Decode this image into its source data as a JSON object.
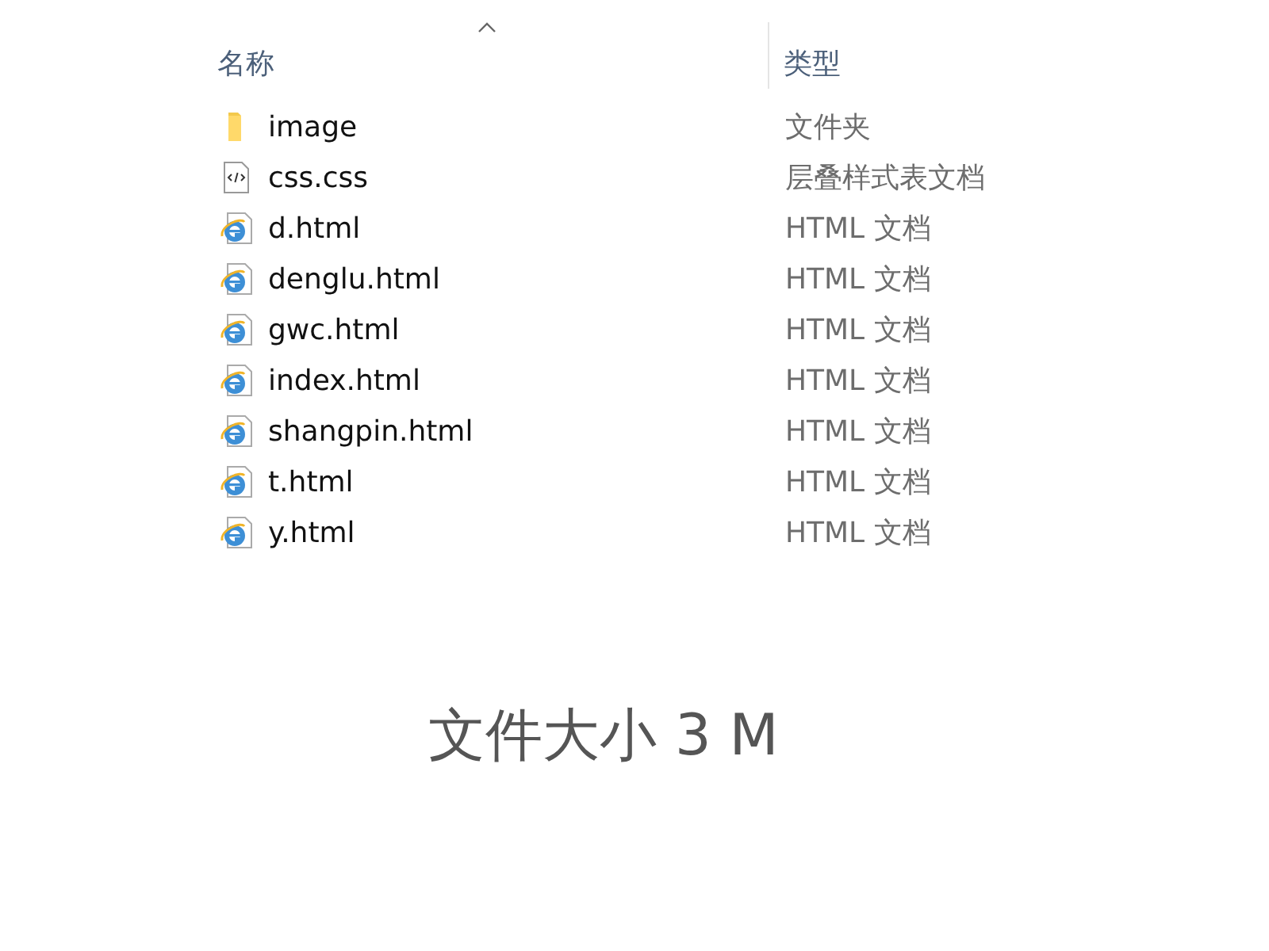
{
  "columns": {
    "name": {
      "label": "名称",
      "sorted": true
    },
    "type": {
      "label": "类型"
    }
  },
  "files": [
    {
      "name": "image",
      "type": "文件夹",
      "kind": "folder"
    },
    {
      "name": "css.css",
      "type": "层叠样式表文档",
      "kind": "css"
    },
    {
      "name": "d.html",
      "type": "HTML 文档",
      "kind": "html"
    },
    {
      "name": "denglu.html",
      "type": "HTML 文档",
      "kind": "html"
    },
    {
      "name": "gwc.html",
      "type": "HTML 文档",
      "kind": "html"
    },
    {
      "name": "index.html",
      "type": "HTML 文档",
      "kind": "html"
    },
    {
      "name": "shangpin.html",
      "type": "HTML 文档",
      "kind": "html"
    },
    {
      "name": "t.html",
      "type": "HTML 文档",
      "kind": "html"
    },
    {
      "name": "y.html",
      "type": "HTML 文档",
      "kind": "html"
    }
  ],
  "caption": "文件大小 3 M"
}
